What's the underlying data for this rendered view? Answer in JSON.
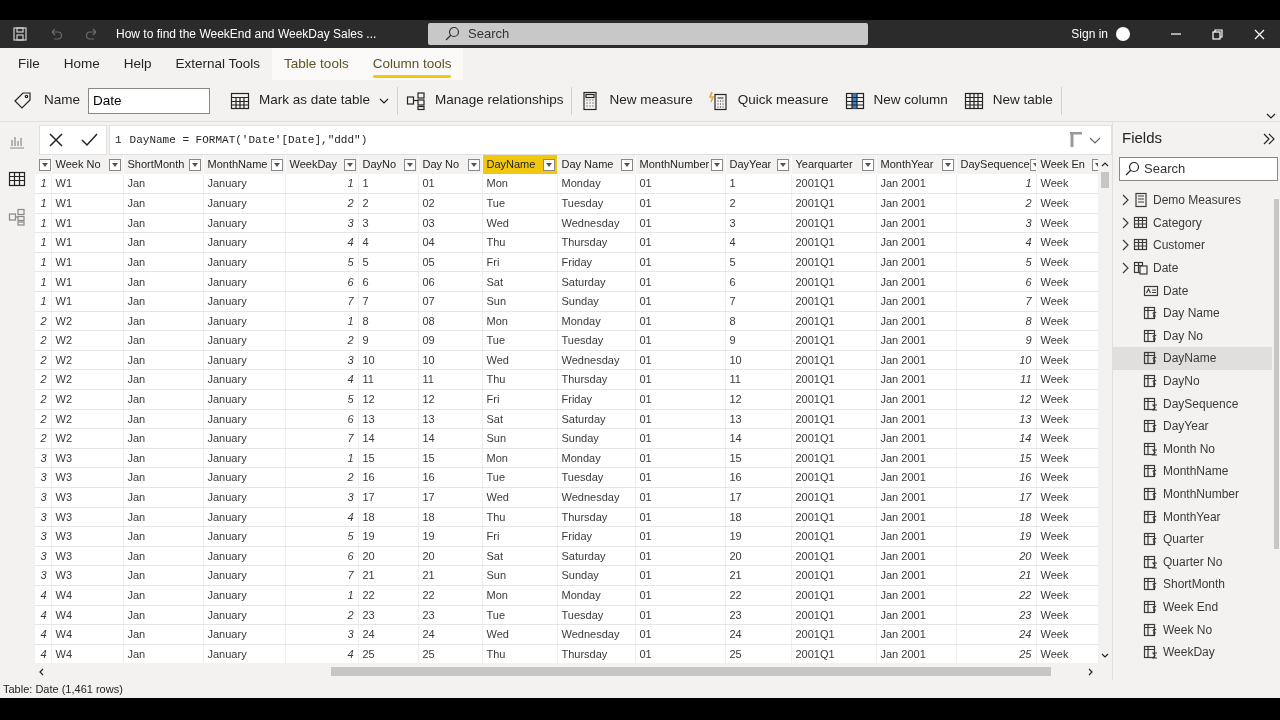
{
  "title_bar": {
    "quick_access": [
      {
        "kind": "save",
        "disabled": false
      },
      {
        "kind": "undo",
        "disabled": true
      },
      {
        "kind": "redo",
        "disabled": true
      }
    ],
    "title": "How to find the WeekEnd and WeekDay Sales ...",
    "search_placeholder": "Search",
    "sign_in": "Sign in"
  },
  "ribbon_tabs": [
    {
      "label": "File",
      "selected": false,
      "contextual": false
    },
    {
      "label": "Home",
      "selected": false,
      "contextual": false
    },
    {
      "label": "Help",
      "selected": false,
      "contextual": false
    },
    {
      "label": "External Tools",
      "selected": false,
      "contextual": false
    },
    {
      "label": "Table tools",
      "selected": false,
      "contextual": true
    },
    {
      "label": "Column tools",
      "selected": true,
      "contextual": true
    }
  ],
  "ribbon": {
    "name_label": "Name",
    "name_value": "Date",
    "commands": [
      {
        "label": "Mark as date table",
        "kind": "calendar",
        "dropdown": true
      },
      {
        "label": "Manage relationships",
        "kind": "relationships",
        "dropdown": false
      },
      {
        "label": "New measure",
        "kind": "calculator",
        "dropdown": false
      },
      {
        "label": "Quick measure",
        "kind": "quick-calculator",
        "dropdown": false
      },
      {
        "label": "New column",
        "kind": "column",
        "dropdown": false
      },
      {
        "label": "New table",
        "kind": "table",
        "dropdown": false
      }
    ]
  },
  "view_rail": [
    {
      "kind": "report",
      "selected": false
    },
    {
      "kind": "data",
      "selected": true
    },
    {
      "kind": "model",
      "selected": false
    }
  ],
  "formula_bar": {
    "line_number": "1",
    "formula": "DayName = FORMAT('Date'[Date],\"ddd\")"
  },
  "table": {
    "columns": [
      {
        "kind": "number",
        "selected": false
      },
      {
        "label": "Week No",
        "kind": "text",
        "selected": false
      },
      {
        "label": "ShortMonth",
        "kind": "text",
        "selected": false
      },
      {
        "label": "MonthName",
        "kind": "text",
        "selected": false
      },
      {
        "label": "WeekDay",
        "kind": "number",
        "selected": false
      },
      {
        "label": "DayNo",
        "kind": "text",
        "selected": false
      },
      {
        "label": "Day No",
        "kind": "text",
        "selected": false
      },
      {
        "label": "DayName",
        "kind": "text",
        "selected": true
      },
      {
        "label": "Day Name",
        "kind": "text",
        "selected": false
      },
      {
        "label": "MonthNumber",
        "kind": "text",
        "selected": false
      },
      {
        "label": "DayYear",
        "kind": "text",
        "selected": false
      },
      {
        "label": "Yearquarter",
        "kind": "text",
        "selected": false
      },
      {
        "label": "MonthYear",
        "kind": "text",
        "selected": false
      },
      {
        "label": "DaySequence",
        "kind": "number",
        "selected": false
      },
      {
        "label": "Week En",
        "kind": "text",
        "selected": false
      }
    ],
    "rows": [
      [
        "1",
        "W1",
        "Jan",
        "January",
        "1",
        "1",
        "01",
        "Mon",
        "Monday",
        "01",
        "1",
        "2001Q1",
        "Jan 2001",
        "1",
        "Week"
      ],
      [
        "1",
        "W1",
        "Jan",
        "January",
        "2",
        "2",
        "02",
        "Tue",
        "Tuesday",
        "01",
        "2",
        "2001Q1",
        "Jan 2001",
        "2",
        "Week"
      ],
      [
        "1",
        "W1",
        "Jan",
        "January",
        "3",
        "3",
        "03",
        "Wed",
        "Wednesday",
        "01",
        "3",
        "2001Q1",
        "Jan 2001",
        "3",
        "Week"
      ],
      [
        "1",
        "W1",
        "Jan",
        "January",
        "4",
        "4",
        "04",
        "Thu",
        "Thursday",
        "01",
        "4",
        "2001Q1",
        "Jan 2001",
        "4",
        "Week"
      ],
      [
        "1",
        "W1",
        "Jan",
        "January",
        "5",
        "5",
        "05",
        "Fri",
        "Friday",
        "01",
        "5",
        "2001Q1",
        "Jan 2001",
        "5",
        "Week"
      ],
      [
        "1",
        "W1",
        "Jan",
        "January",
        "6",
        "6",
        "06",
        "Sat",
        "Saturday",
        "01",
        "6",
        "2001Q1",
        "Jan 2001",
        "6",
        "Week"
      ],
      [
        "1",
        "W1",
        "Jan",
        "January",
        "7",
        "7",
        "07",
        "Sun",
        "Sunday",
        "01",
        "7",
        "2001Q1",
        "Jan 2001",
        "7",
        "Week"
      ],
      [
        "2",
        "W2",
        "Jan",
        "January",
        "1",
        "8",
        "08",
        "Mon",
        "Monday",
        "01",
        "8",
        "2001Q1",
        "Jan 2001",
        "8",
        "Week"
      ],
      [
        "2",
        "W2",
        "Jan",
        "January",
        "2",
        "9",
        "09",
        "Tue",
        "Tuesday",
        "01",
        "9",
        "2001Q1",
        "Jan 2001",
        "9",
        "Week"
      ],
      [
        "2",
        "W2",
        "Jan",
        "January",
        "3",
        "10",
        "10",
        "Wed",
        "Wednesday",
        "01",
        "10",
        "2001Q1",
        "Jan 2001",
        "10",
        "Week"
      ],
      [
        "2",
        "W2",
        "Jan",
        "January",
        "4",
        "11",
        "11",
        "Thu",
        "Thursday",
        "01",
        "11",
        "2001Q1",
        "Jan 2001",
        "11",
        "Week"
      ],
      [
        "2",
        "W2",
        "Jan",
        "January",
        "5",
        "12",
        "12",
        "Fri",
        "Friday",
        "01",
        "12",
        "2001Q1",
        "Jan 2001",
        "12",
        "Week"
      ],
      [
        "2",
        "W2",
        "Jan",
        "January",
        "6",
        "13",
        "13",
        "Sat",
        "Saturday",
        "01",
        "13",
        "2001Q1",
        "Jan 2001",
        "13",
        "Week"
      ],
      [
        "2",
        "W2",
        "Jan",
        "January",
        "7",
        "14",
        "14",
        "Sun",
        "Sunday",
        "01",
        "14",
        "2001Q1",
        "Jan 2001",
        "14",
        "Week"
      ],
      [
        "3",
        "W3",
        "Jan",
        "January",
        "1",
        "15",
        "15",
        "Mon",
        "Monday",
        "01",
        "15",
        "2001Q1",
        "Jan 2001",
        "15",
        "Week"
      ],
      [
        "3",
        "W3",
        "Jan",
        "January",
        "2",
        "16",
        "16",
        "Tue",
        "Tuesday",
        "01",
        "16",
        "2001Q1",
        "Jan 2001",
        "16",
        "Week"
      ],
      [
        "3",
        "W3",
        "Jan",
        "January",
        "3",
        "17",
        "17",
        "Wed",
        "Wednesday",
        "01",
        "17",
        "2001Q1",
        "Jan 2001",
        "17",
        "Week"
      ],
      [
        "3",
        "W3",
        "Jan",
        "January",
        "4",
        "18",
        "18",
        "Thu",
        "Thursday",
        "01",
        "18",
        "2001Q1",
        "Jan 2001",
        "18",
        "Week"
      ],
      [
        "3",
        "W3",
        "Jan",
        "January",
        "5",
        "19",
        "19",
        "Fri",
        "Friday",
        "01",
        "19",
        "2001Q1",
        "Jan 2001",
        "19",
        "Week"
      ],
      [
        "3",
        "W3",
        "Jan",
        "January",
        "6",
        "20",
        "20",
        "Sat",
        "Saturday",
        "01",
        "20",
        "2001Q1",
        "Jan 2001",
        "20",
        "Week"
      ],
      [
        "3",
        "W3",
        "Jan",
        "January",
        "7",
        "21",
        "21",
        "Sun",
        "Sunday",
        "01",
        "21",
        "2001Q1",
        "Jan 2001",
        "21",
        "Week"
      ],
      [
        "4",
        "W4",
        "Jan",
        "January",
        "1",
        "22",
        "22",
        "Mon",
        "Monday",
        "01",
        "22",
        "2001Q1",
        "Jan 2001",
        "22",
        "Week"
      ],
      [
        "4",
        "W4",
        "Jan",
        "January",
        "2",
        "23",
        "23",
        "Tue",
        "Tuesday",
        "01",
        "23",
        "2001Q1",
        "Jan 2001",
        "23",
        "Week"
      ],
      [
        "4",
        "W4",
        "Jan",
        "January",
        "3",
        "24",
        "24",
        "Wed",
        "Wednesday",
        "01",
        "24",
        "2001Q1",
        "Jan 2001",
        "24",
        "Week"
      ],
      [
        "4",
        "W4",
        "Jan",
        "January",
        "4",
        "25",
        "25",
        "Thu",
        "Thursday",
        "01",
        "25",
        "2001Q1",
        "Jan 2001",
        "25",
        "Week"
      ]
    ]
  },
  "fields": {
    "title": "Fields",
    "search_placeholder": "Search",
    "items": [
      {
        "label": "Demo Measures",
        "kind": "measures",
        "selected": false
      },
      {
        "label": "Category",
        "kind": "table",
        "selected": false
      },
      {
        "label": "Customer",
        "kind": "table",
        "selected": false
      },
      {
        "label": "Date",
        "kind": "date-table",
        "selected": false,
        "children": [
          {
            "label": "Date",
            "kind": "date",
            "selected": false
          },
          {
            "label": "Day Name",
            "kind": "text-column",
            "selected": false
          },
          {
            "label": "Day No",
            "kind": "text-column",
            "selected": false
          },
          {
            "label": "DayName",
            "kind": "text-column",
            "selected": true
          },
          {
            "label": "DayNo",
            "kind": "text-column",
            "selected": false
          },
          {
            "label": "DaySequence",
            "kind": "number-column",
            "selected": false
          },
          {
            "label": "DayYear",
            "kind": "text-column",
            "selected": false
          },
          {
            "label": "Month No",
            "kind": "number-column",
            "selected": false
          },
          {
            "label": "MonthName",
            "kind": "text-column",
            "selected": false
          },
          {
            "label": "MonthNumber",
            "kind": "text-column",
            "selected": false
          },
          {
            "label": "MonthYear",
            "kind": "text-column",
            "selected": false
          },
          {
            "label": "Quarter",
            "kind": "text-column",
            "selected": false
          },
          {
            "label": "Quarter No",
            "kind": "number-column",
            "selected": false
          },
          {
            "label": "ShortMonth",
            "kind": "text-column",
            "selected": false
          },
          {
            "label": "Week End",
            "kind": "text-column",
            "selected": false
          },
          {
            "label": "Week No",
            "kind": "text-column",
            "selected": false
          },
          {
            "label": "WeekDay",
            "kind": "number-column",
            "selected": false
          }
        ]
      }
    ]
  },
  "status_bar": "Table: Date (1,461 rows)"
}
